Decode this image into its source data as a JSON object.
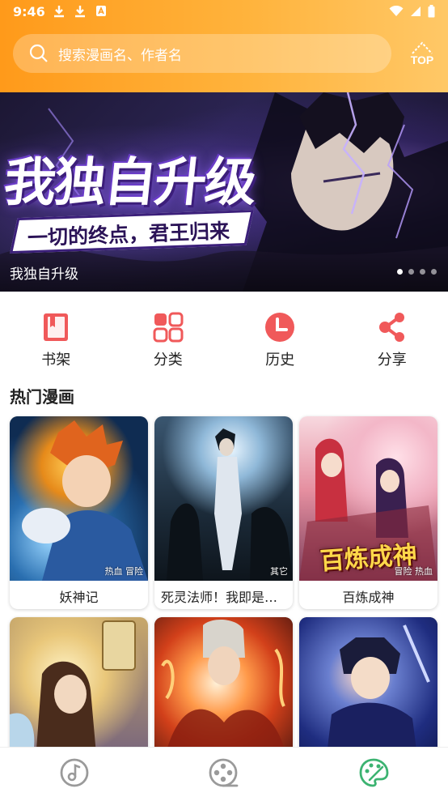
{
  "status_bar": {
    "time": "9:46",
    "notification_icons": [
      "download-icon",
      "download-icon",
      "font-app-icon"
    ],
    "system_icons": [
      "wifi-icon",
      "signal-icon",
      "battery-icon"
    ]
  },
  "header": {
    "gradient_colors": [
      "#ff9a1a",
      "#ffc867"
    ],
    "search_placeholder": "搜索漫画名、作者名",
    "top_button_label": "TOP"
  },
  "banner": {
    "art_title": "我独自升级",
    "art_slogan": "一切的终点，君王归来",
    "caption": "我独自升级",
    "slide_count": 4,
    "active_slide": 1
  },
  "shortcuts": [
    {
      "label": "书架",
      "icon": "bookshelf-icon",
      "color": "#f0595a"
    },
    {
      "label": "分类",
      "icon": "category-grid-icon",
      "color": "#f0595a"
    },
    {
      "label": "历史",
      "icon": "history-clock-icon",
      "color": "#f0595a"
    },
    {
      "label": "分享",
      "icon": "share-icon",
      "color": "#f0595a"
    }
  ],
  "section": {
    "title": "热门漫画"
  },
  "comics": [
    {
      "title": "妖神记",
      "tags": "热血 冒险"
    },
    {
      "title": "死灵法师！我即是天灾",
      "tags": "其它"
    },
    {
      "title": "百炼成神",
      "tags": "冒险 热血",
      "cover_text": "百炼成神"
    },
    {
      "title": "",
      "tags": ""
    },
    {
      "title": "",
      "tags": ""
    },
    {
      "title": "",
      "tags": ""
    }
  ],
  "bottom_nav": {
    "items": [
      {
        "icon": "music-disc-icon",
        "active": false
      },
      {
        "icon": "film-reel-icon",
        "active": false
      },
      {
        "icon": "palette-icon",
        "active": true
      }
    ],
    "inactive_color": "#9a9a9a",
    "active_color": "#3cb371"
  }
}
